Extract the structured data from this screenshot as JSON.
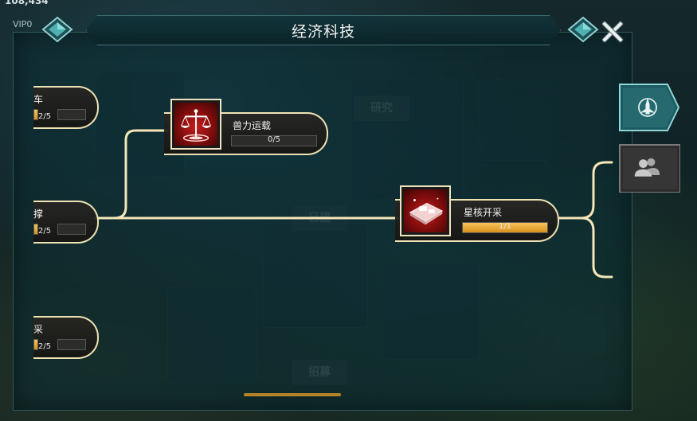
{
  "header": {
    "resource_value": "108,434",
    "vip_label": "VIP0",
    "title": "经济科技"
  },
  "background_labels": {
    "research": "研究",
    "recruit": "招募",
    "partial": "已建"
  },
  "left_nodes": [
    {
      "name": "车",
      "progress_text": "2/5",
      "progress": 0.4
    },
    {
      "name": "撑",
      "progress_text": "2/5",
      "progress": 0.4
    },
    {
      "name": "采",
      "progress_text": "2/5",
      "progress": 0.4
    }
  ],
  "nodes": [
    {
      "name": "兽力运载",
      "progress_text": "0/5",
      "progress": 0.0,
      "icon": "balance-scale-icon"
    },
    {
      "name": "星核开采",
      "progress_text": "1/1",
      "progress": 1.0,
      "icon": "mining-platform-icon"
    }
  ],
  "side_tabs": [
    {
      "icon": "rocket-emblem-icon",
      "active": true
    },
    {
      "icon": "alliance-members-icon",
      "active": false
    }
  ],
  "colors": {
    "connector": "#f4e6b8",
    "progress_fill": "#eea53a",
    "icon_bg": "#b01818",
    "panel_border": "#6fb0b4"
  }
}
